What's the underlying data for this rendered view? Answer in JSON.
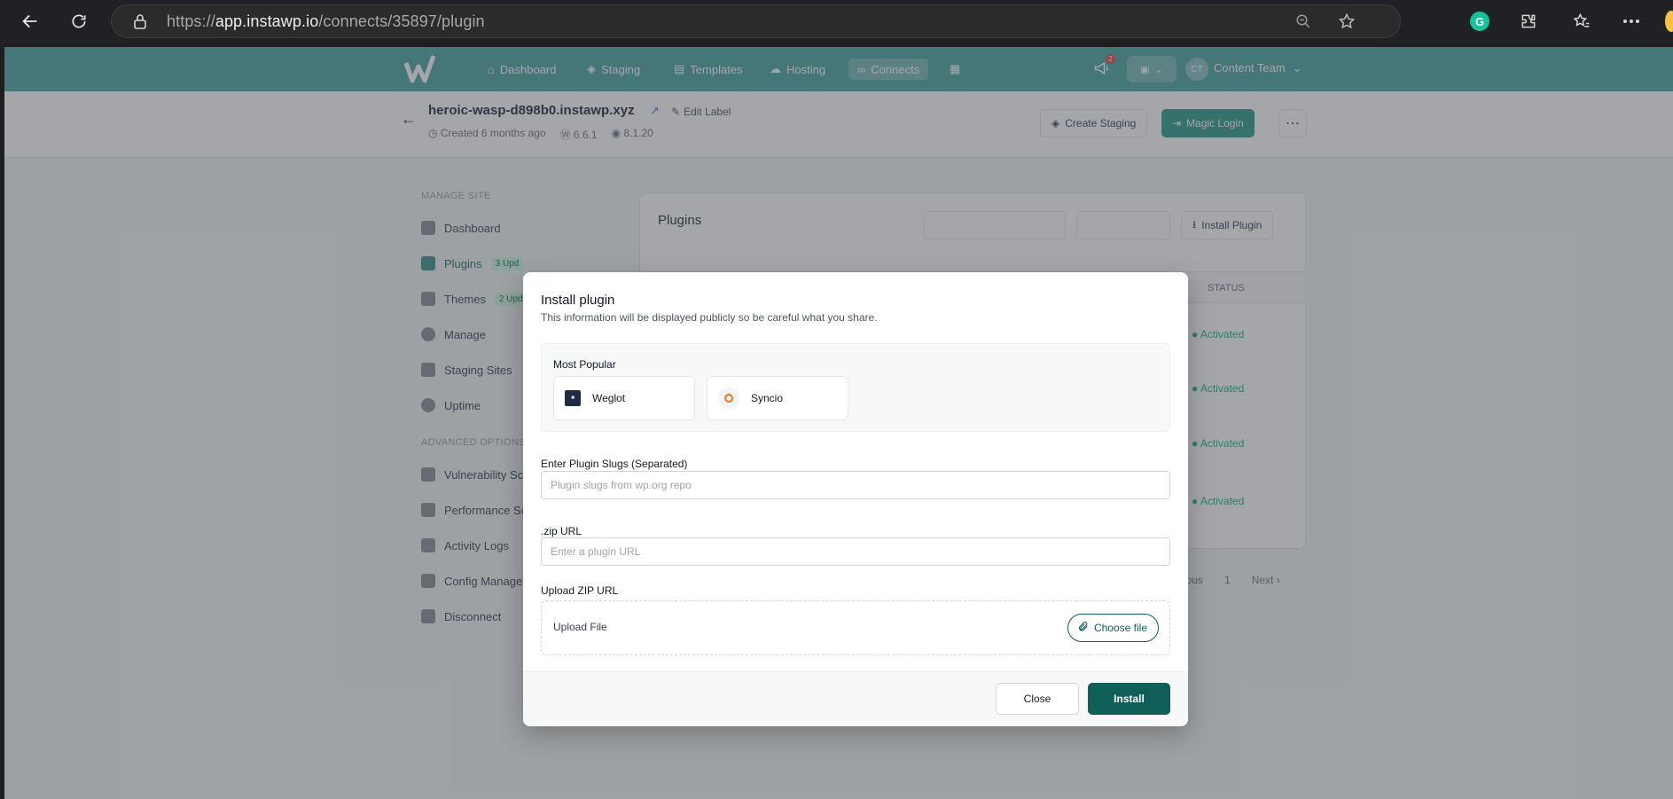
{
  "browser": {
    "url_prefix": "https://",
    "url_host": "app.instawp.io",
    "url_path": "/connects/35897/plugin"
  },
  "appbar": {
    "nav": [
      {
        "label": "Dashboard",
        "icon": "home-icon"
      },
      {
        "label": "Staging",
        "icon": "cube-icon"
      },
      {
        "label": "Templates",
        "icon": "template-icon"
      },
      {
        "label": "Hosting",
        "icon": "cloud-icon"
      },
      {
        "label": "Connects",
        "icon": "link-icon"
      }
    ],
    "notifications_count": "2",
    "user_initials": "CT",
    "user_name": "Content Team"
  },
  "site": {
    "domain": "heroic-wasp-d898b0.instawp.xyz",
    "edit_label": "Edit Label",
    "created": "Created 6 months ago",
    "wp_version": "6.6.1",
    "php_version": "8.1.20",
    "create_staging": "Create Staging",
    "magic_login": "Magic Login"
  },
  "sidebar": {
    "manage_heading": "MANAGE SITE",
    "manage_items": [
      {
        "label": "Dashboard"
      },
      {
        "label": "Plugins",
        "badge": "3 Upd"
      },
      {
        "label": "Themes",
        "badge": "2 Upd"
      },
      {
        "label": "Manage"
      },
      {
        "label": "Staging Sites"
      },
      {
        "label": "Uptime"
      }
    ],
    "advanced_heading": "ADVANCED OPTIONS",
    "advanced_items": [
      {
        "label": "Vulnerability Sc"
      },
      {
        "label": "Performance Sc"
      },
      {
        "label": "Activity Logs"
      },
      {
        "label": "Config Manager"
      },
      {
        "label": "Disconnect"
      }
    ]
  },
  "plugins_card": {
    "title": "Plugins",
    "install_plugin": "Install Plugin",
    "status_header": "STATUS",
    "statuses": [
      "Activated",
      "Activated",
      "Activated",
      "Activated"
    ],
    "pagination": {
      "previous": "ious",
      "page": "1",
      "next": "Next"
    }
  },
  "modal": {
    "title": "Install plugin",
    "subtitle": "This information will be displayed publicly so be careful what you share.",
    "most_popular_label": "Most Popular",
    "popular": [
      {
        "name": "Weglot"
      },
      {
        "name": "Syncio"
      }
    ],
    "slugs_label": "Enter Plugin Slugs (Separated)",
    "slugs_placeholder": "Plugin slugs from wp.org repo",
    "zip_label": ".zip URL",
    "zip_placeholder": "Enter a plugin URL",
    "upload_label": "Upload ZIP URL",
    "upload_text": "Upload File",
    "choose_file": "Choose file",
    "close": "Close",
    "install": "Install"
  }
}
